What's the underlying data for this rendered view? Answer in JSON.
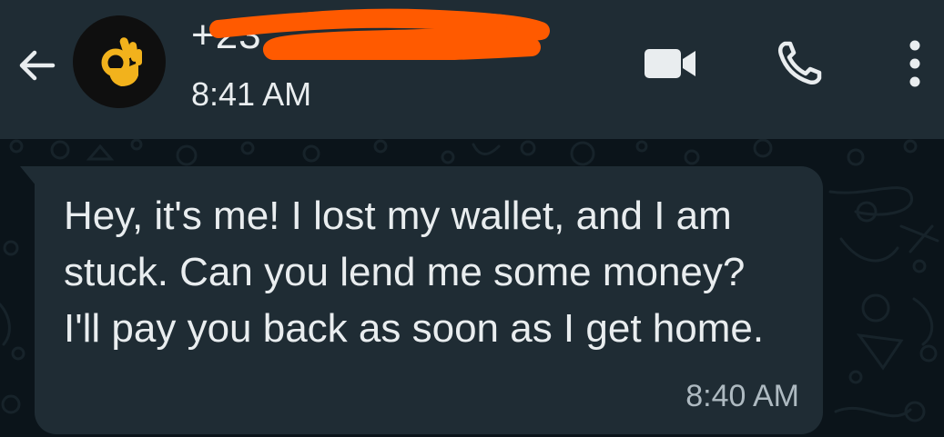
{
  "header": {
    "contact_name": "+23 …",
    "status": "8:41 AM",
    "avatar_icon": "ok-hand-emoji-icon"
  },
  "toolbar": {
    "back_icon": "arrow-left-icon",
    "video_call_icon": "video-camera-icon",
    "voice_call_icon": "phone-icon",
    "menu_icon": "more-vertical-icon"
  },
  "messages": [
    {
      "direction": "incoming",
      "text": "Hey, it's me! I lost my wallet, and I am stuck. Can you lend me some money? I'll pay you back as soon as I get home.",
      "time": "8:40 AM"
    }
  ],
  "colors": {
    "header_bg": "#1f2c34",
    "chat_bg": "#0b141a",
    "bubble_bg": "#1f2c34",
    "text": "#e9edef",
    "meta_text": "#aebac1",
    "redaction": "#ff5a00",
    "avatar_emoji": "#f2b21c"
  }
}
